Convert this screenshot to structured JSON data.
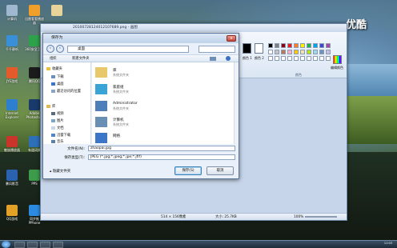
{
  "desktop": {
    "icons": [
      {
        "label": "计算机",
        "color": "#9fb8cf"
      },
      {
        "label": "迅雷看看播放器",
        "color": "#f0a02a"
      },
      {
        "label": "",
        "color": "#e8d49a"
      },
      {
        "label": "千千静听",
        "color": "#3a8fd9"
      },
      {
        "label": "360安全卫士",
        "color": "#2ea24b"
      },
      {
        "label": "JYS游戏",
        "color": "#e55a2b"
      },
      {
        "label": "腾讯QQ",
        "color": "#1b1b1b"
      },
      {
        "label": "Internet Explorer",
        "color": "#2f7fd0"
      },
      {
        "label": "Adobe Photoshop",
        "color": "#1a3a6b"
      },
      {
        "label": "魅族播放器",
        "color": "#c9342b"
      },
      {
        "label": "有道词典",
        "color": "#2d6fb8"
      },
      {
        "label": "暴风影音",
        "color": "#2b62b0"
      },
      {
        "label": "PPS",
        "color": "#3c9c4b"
      },
      {
        "label": "QQ游戏",
        "color": "#e3a227"
      },
      {
        "label": "同步推PPhone",
        "color": "#2c8be0"
      }
    ],
    "watermark": "优酷"
  },
  "paint": {
    "title": "20100728124012107689.png - 画图",
    "color1_label": "颜色 1",
    "color2_label": "颜色 2",
    "edit_colors_label": "编辑颜色",
    "colors_group_label": "颜色",
    "palette": [
      "#000000",
      "#7f7f7f",
      "#880015",
      "#ed1c24",
      "#ff7f27",
      "#fff200",
      "#22b14c",
      "#00a2e8",
      "#3f48cc",
      "#a349a4",
      "#ffffff",
      "#c3c3c3",
      "#b97a57",
      "#ffaec9",
      "#ffc90e",
      "#efe4b0",
      "#b5e61d",
      "#99d9ea",
      "#7092be",
      "#c8bfe7",
      "#ffffff",
      "#ffffff",
      "#ffffff",
      "#ffffff",
      "#ffffff",
      "#ffffff",
      "#ffffff",
      "#ffffff",
      "#ffffff",
      "#ffffff"
    ],
    "status": {
      "dimensions": "514 × 156像素",
      "filesize": "大小: 25.7KB",
      "zoom": "100%"
    }
  },
  "dialog": {
    "title": "保存为",
    "close": "x",
    "address": "桌面",
    "search_placeholder": "",
    "toolbar": {
      "organize": "组织",
      "new_folder": "新建文件夹"
    },
    "nav": {
      "favorites": "收藏夹",
      "downloads": "下载",
      "desktop": "桌面",
      "recent": "最近访问的位置",
      "libraries": "库",
      "videos": "视频",
      "pictures": "图片",
      "documents": "文档",
      "thunder": "迅雷下载",
      "music": "音乐"
    },
    "files": [
      {
        "name": "库",
        "type": "系统文件夹",
        "color": "#e8c86b"
      },
      {
        "name": "家庭组",
        "type": "系统文件夹",
        "color": "#3aa4d6"
      },
      {
        "name": "Administrator",
        "type": "系统文件夹",
        "color": "#4f7fb8"
      },
      {
        "name": "计算机",
        "type": "系统文件夹",
        "color": "#6a8fb4"
      },
      {
        "name": "网络",
        "type": "",
        "color": "#3b77c6"
      }
    ],
    "filename_label": "文件名(N):",
    "filename_value": "zhaopai.jpg",
    "filetype_label": "保存类型(T):",
    "filetype_value": "JPEG (*.jpg;*.jpeg;*.jpe;*.jfif)",
    "hide_folders": "隐藏文件夹",
    "save_button": "保存(S)",
    "cancel_button": "取消"
  },
  "taskbar": {
    "clock_time": "11:03",
    "clock_date": ""
  }
}
